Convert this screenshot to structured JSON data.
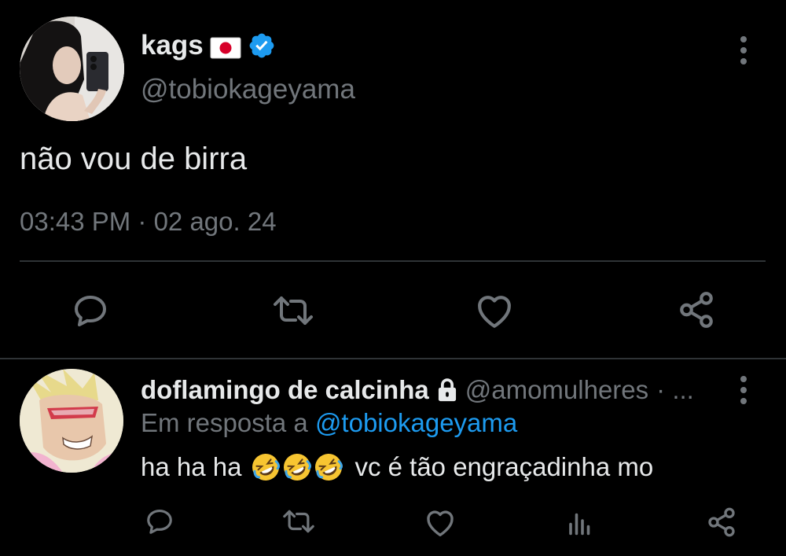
{
  "tweet": {
    "display_name": "kags",
    "flag_icon": "japan-flag-icon",
    "verified_icon": "verified-badge-icon",
    "handle": "@tobiokageyama",
    "text": "não vou de birra",
    "timestamp": "03:43 PM · 02 ago. 24",
    "actions": [
      "reply-icon",
      "retweet-icon",
      "like-icon",
      "share-icon"
    ]
  },
  "reply": {
    "display_name": "doflamingo de calcinha",
    "lock_icon": "lock-icon",
    "handle": "@amomulheres",
    "separator": "· ...",
    "reply_prefix": "Em resposta a",
    "reply_mention": "@tobiokageyama",
    "text_before": "ha ha ha",
    "emoji": [
      "rofl-emoji",
      "rofl-emoji",
      "rofl-emoji"
    ],
    "text_after": "vc é tão engraçadinha mo",
    "actions": [
      "reply-icon",
      "retweet-icon",
      "like-icon",
      "analytics-icon",
      "share-icon"
    ]
  },
  "colors": {
    "background": "#000000",
    "text_primary": "#e7e9ea",
    "text_secondary": "#71767b",
    "accent": "#1d9bf0",
    "divider": "#2f3336"
  }
}
